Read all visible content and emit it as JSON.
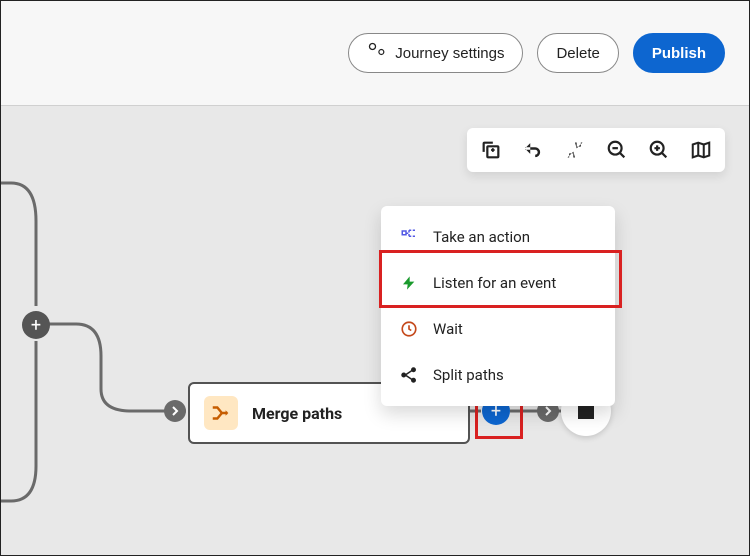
{
  "header": {
    "journey_settings_label": "Journey settings",
    "delete_label": "Delete",
    "publish_label": "Publish"
  },
  "toolbar": {
    "icons": [
      "copy",
      "undo",
      "collapse",
      "zoom-out",
      "zoom-in",
      "map"
    ]
  },
  "canvas": {
    "add_junction_label": "+",
    "node": {
      "label": "Merge paths"
    },
    "plus_label": "+"
  },
  "popover": {
    "items": [
      {
        "icon": "action",
        "label": "Take an action"
      },
      {
        "icon": "event",
        "label": "Listen for an event"
      },
      {
        "icon": "wait",
        "label": "Wait"
      },
      {
        "icon": "split",
        "label": "Split paths"
      }
    ],
    "highlighted_index": 1
  }
}
